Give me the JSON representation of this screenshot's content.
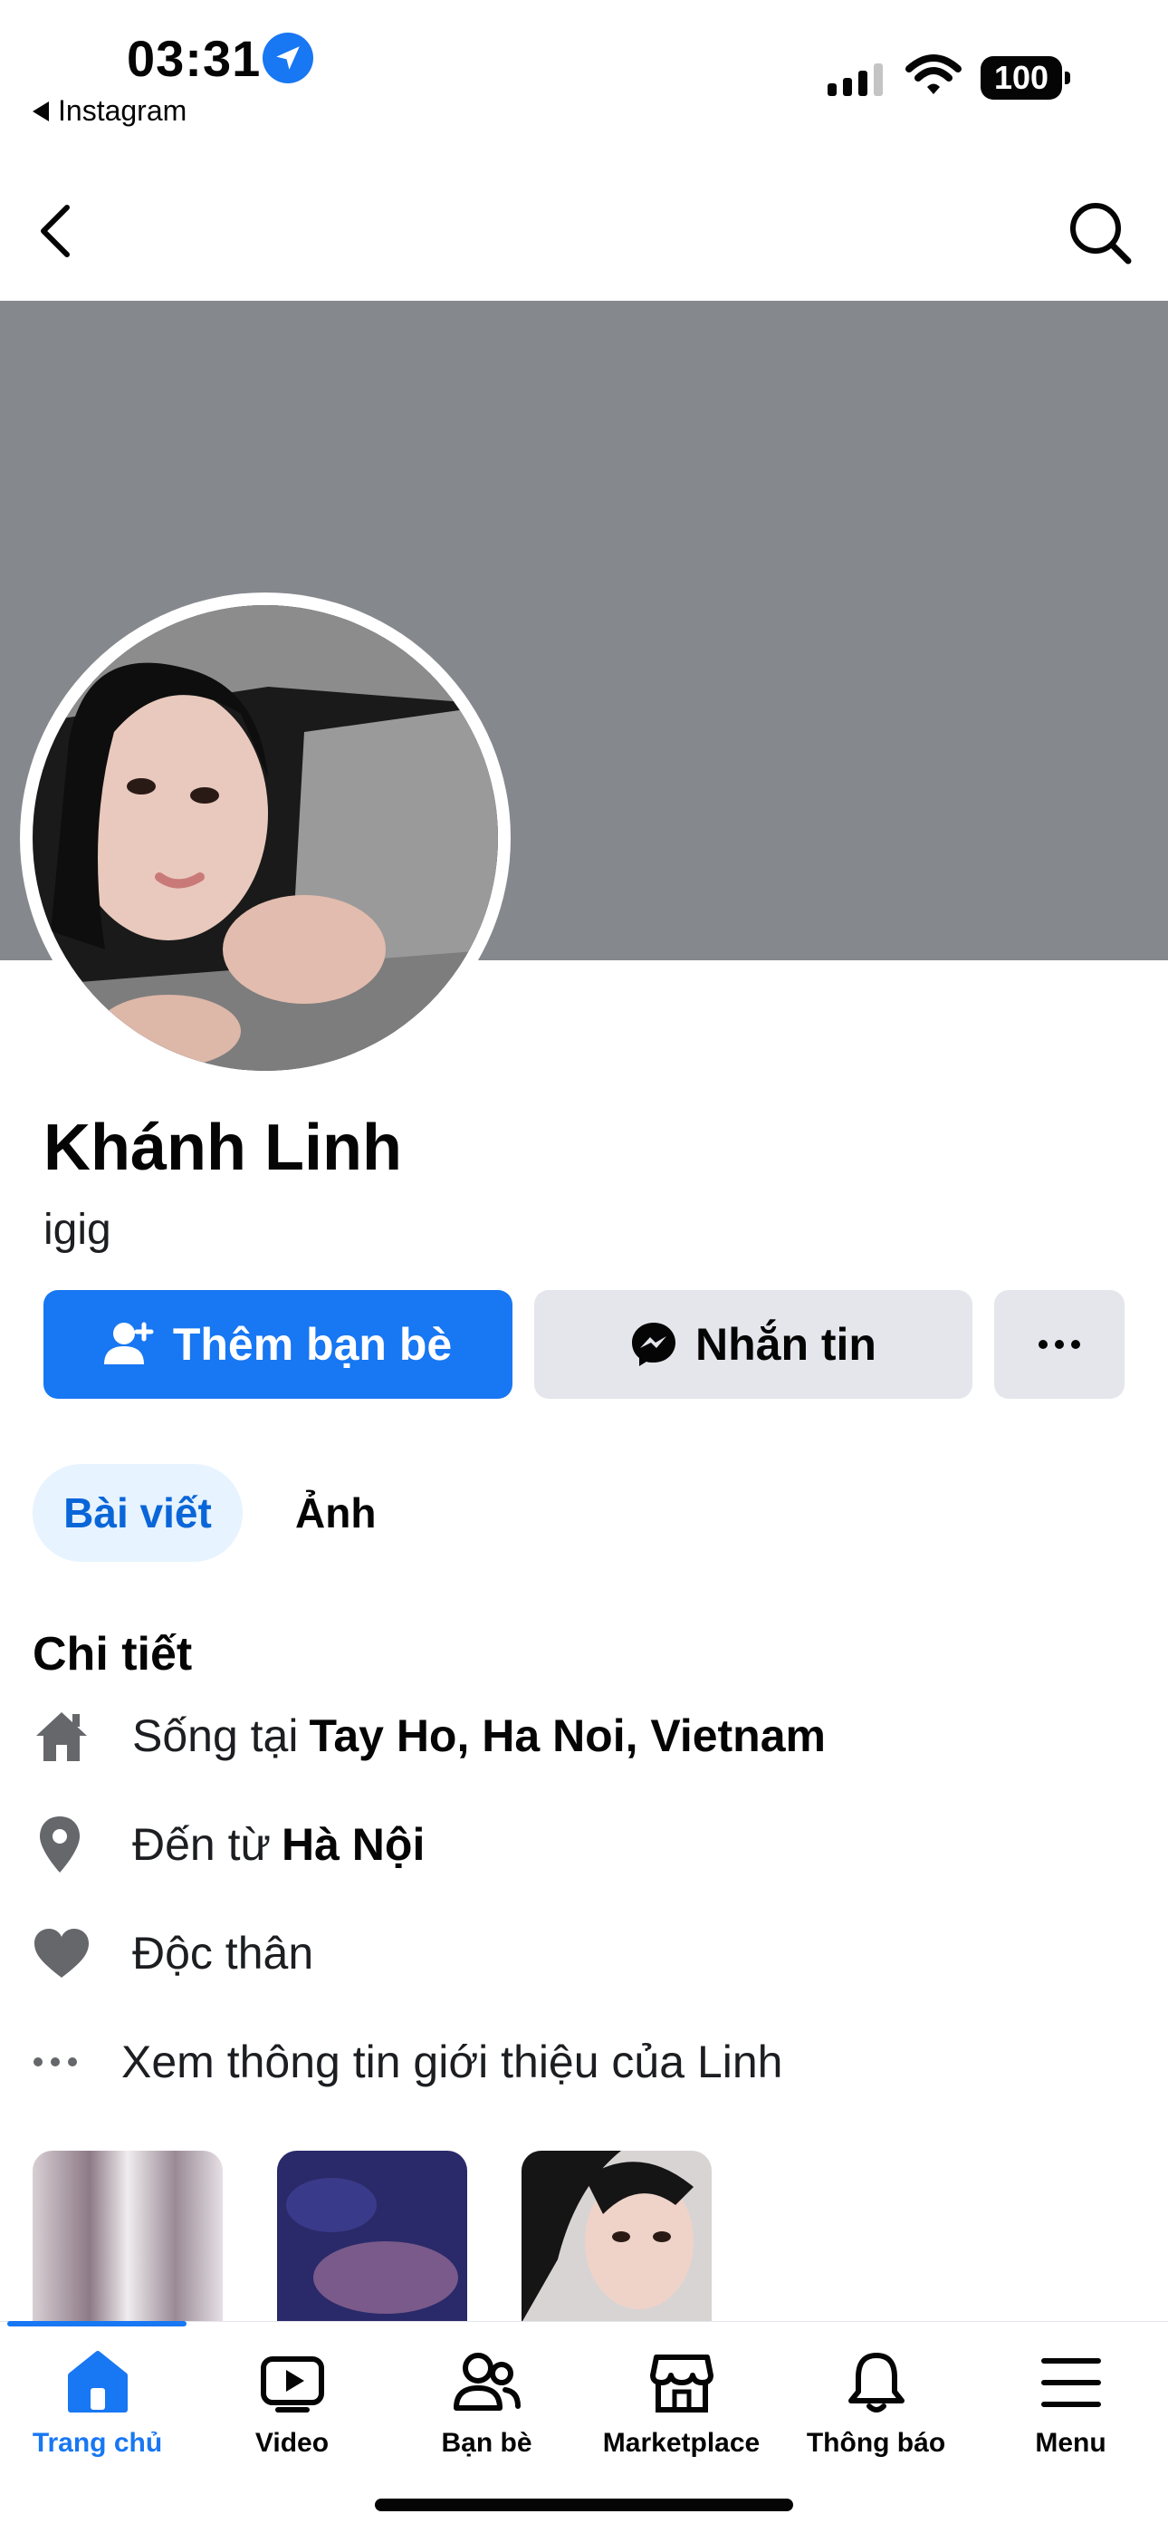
{
  "status_bar": {
    "time": "03:31",
    "back_app": "Instagram",
    "battery": "100"
  },
  "nav": {
    "back_icon": "chevron-left-icon",
    "search_icon": "search-icon"
  },
  "profile": {
    "name": "Khánh Linh",
    "subtitle": "igig",
    "cover_color": "#85888d"
  },
  "actions": {
    "add_friend": "Thêm bạn bè",
    "message": "Nhắn tin",
    "more_icon": "more-dots-icon"
  },
  "tabs": [
    {
      "label": "Bài viết",
      "active": true
    },
    {
      "label": "Ảnh",
      "active": false
    }
  ],
  "details": {
    "title": "Chi tiết",
    "lives_prefix": "Sống tại",
    "lives_value": "Tay Ho, Ha Noi, Vietnam",
    "from_prefix": "Đến từ",
    "from_value": "Hà Nội",
    "relationship": "Độc thân",
    "see_intro": "Xem thông tin giới thiệu của Linh"
  },
  "bottom_tabs": [
    {
      "label": "Trang chủ",
      "icon": "home-icon",
      "active": true
    },
    {
      "label": "Video",
      "icon": "video-icon",
      "active": false
    },
    {
      "label": "Bạn bè",
      "icon": "friends-icon",
      "active": false
    },
    {
      "label": "Marketplace",
      "icon": "marketplace-icon",
      "active": false
    },
    {
      "label": "Thông báo",
      "icon": "bell-icon",
      "active": false
    },
    {
      "label": "Menu",
      "icon": "menu-icon",
      "active": false
    }
  ],
  "colors": {
    "accent": "#1877f2",
    "secondary_button": "#e4e6eb",
    "active_tab_bg": "#e7f3ff"
  }
}
